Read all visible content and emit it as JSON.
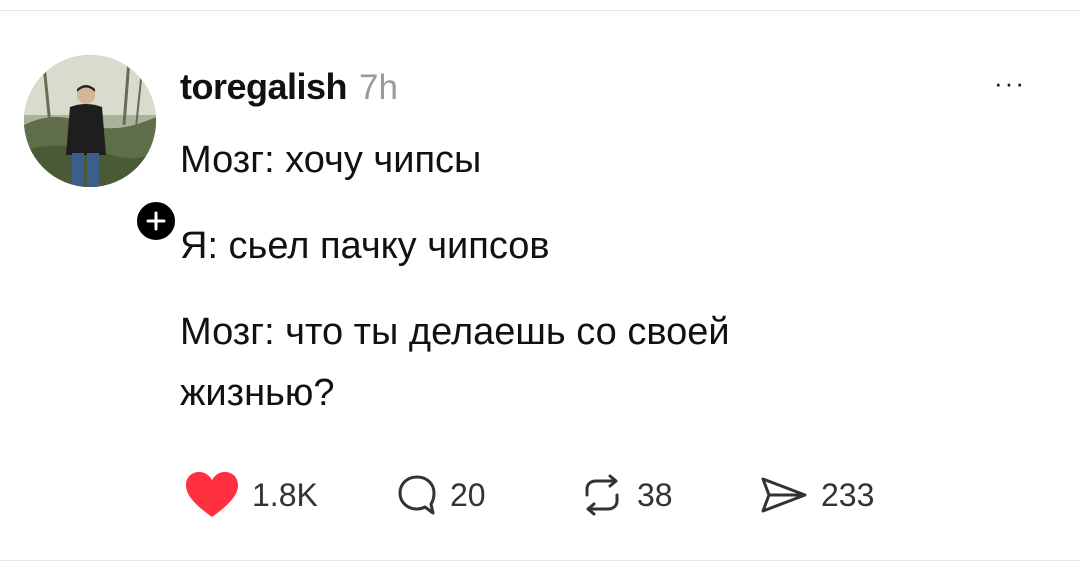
{
  "post": {
    "author": {
      "username": "toregalish",
      "timestamp": "7h",
      "avatar_icon": "user-photo",
      "follow_icon": "plus-icon"
    },
    "more_icon": "more-horizontal-icon",
    "more_label": "···",
    "body_lines": [
      "Мозг: хочу чипсы",
      "Я: сьел пачку чипсов",
      "Мозг: что ты делаешь со своей",
      "жизнью?"
    ],
    "actions": {
      "like": {
        "icon": "heart-icon",
        "count": "1.8K",
        "color": "#ff3040"
      },
      "reply": {
        "icon": "comment-icon",
        "count": "20"
      },
      "repost": {
        "icon": "repost-icon",
        "count": "38"
      },
      "share": {
        "icon": "send-icon",
        "count": "233"
      }
    }
  }
}
